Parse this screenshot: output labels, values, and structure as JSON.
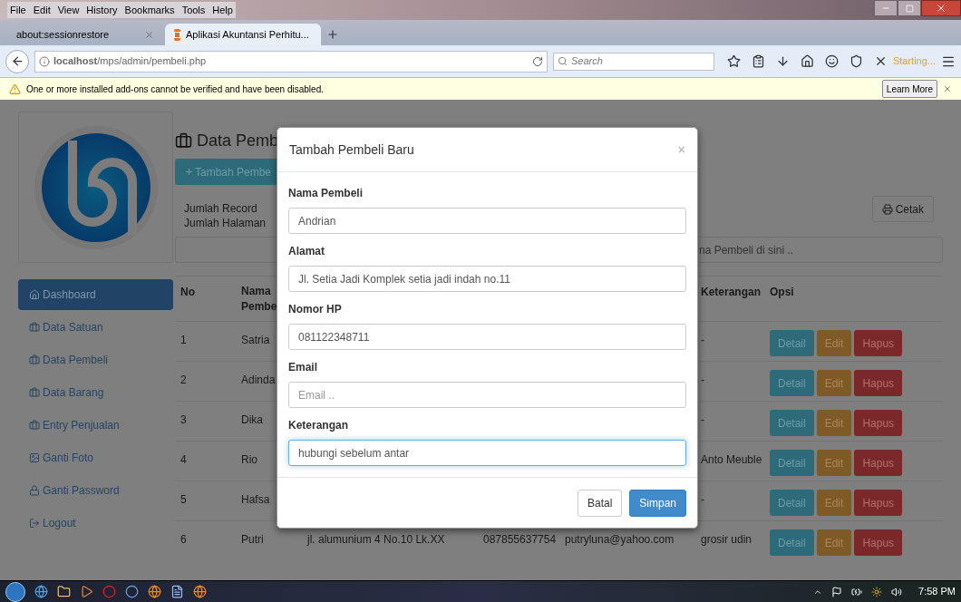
{
  "menu_bar": [
    "File",
    "Edit",
    "View",
    "History",
    "Bookmarks",
    "Tools",
    "Help"
  ],
  "tabs": [
    {
      "label": "about:sessionrestore",
      "selected": false
    },
    {
      "label": "Aplikasi Akuntansi Perhitu...",
      "selected": true
    }
  ],
  "address_bar": {
    "url": "**localhost**/mps/admin/pembeli.php"
  },
  "search": {
    "placeholder": "Search"
  },
  "toolbar_status": "Starting...",
  "notification": {
    "message": "One or more installed add-ons cannot be verified and have been disabled.",
    "button": "Learn More"
  },
  "sidebar": {
    "items": [
      {
        "label": "Dashboard",
        "kind": "home",
        "selected": true
      },
      {
        "label": "Data Satuan",
        "kind": "data",
        "selected": false
      },
      {
        "label": "Data Pembeli",
        "kind": "data",
        "selected": false
      },
      {
        "label": "Data Barang",
        "kind": "data",
        "selected": false
      },
      {
        "label": "Entry Penjualan",
        "kind": "data",
        "selected": false
      },
      {
        "label": "Ganti Foto",
        "kind": "photo",
        "selected": false
      },
      {
        "label": "Ganti Password",
        "kind": "password",
        "selected": false
      },
      {
        "label": "Logout",
        "kind": "logout",
        "selected": false
      }
    ]
  },
  "page": {
    "title": "Data Pemb",
    "add_button": "Tambah Pembe",
    "stats": [
      "Jumlah Record",
      "Jumlah Halaman"
    ],
    "print_button": "Cetak",
    "search_placeholder": "na Pembeli di sini .."
  },
  "table": {
    "columns": [
      "No",
      "Nama Pembe",
      "Keterangan",
      "Opsi"
    ],
    "rows": [
      {
        "no": "1",
        "name": "Satria",
        "keterangan": "-",
        "actions": [
          {
            "label": "Detail",
            "kind": "info"
          },
          {
            "label": "Edit",
            "kind": "warning"
          },
          {
            "label": "Hapus",
            "kind": "danger"
          }
        ]
      },
      {
        "no": "2",
        "name": "Adinda",
        "keterangan": "-",
        "actions": [
          {
            "label": "Detail",
            "kind": "info"
          },
          {
            "label": "Edit",
            "kind": "warning"
          },
          {
            "label": "Hapus",
            "kind": "danger"
          }
        ]
      },
      {
        "no": "3",
        "name": "Dika",
        "keterangan": "-",
        "actions": [
          {
            "label": "Detail",
            "kind": "info"
          },
          {
            "label": "Edit",
            "kind": "warning"
          },
          {
            "label": "Hapus",
            "kind": "danger"
          }
        ]
      },
      {
        "no": "4",
        "name": "Rio",
        "keterangan": "Anto Meuble",
        "actions": [
          {
            "label": "Detail",
            "kind": "info"
          },
          {
            "label": "Edit",
            "kind": "warning"
          },
          {
            "label": "Hapus",
            "kind": "danger"
          }
        ]
      },
      {
        "no": "5",
        "name": "Hafsa",
        "keterangan": "-",
        "actions": [
          {
            "label": "Detail",
            "kind": "info"
          },
          {
            "label": "Edit",
            "kind": "warning"
          },
          {
            "label": "Hapus",
            "kind": "danger"
          }
        ]
      },
      {
        "no": "6",
        "name": "Putri",
        "alamat": "jl. alumunium 4 No.10 Lk.XX",
        "hp": "087855637754",
        "email": "putryluna@yahoo.com",
        "keterangan": "grosir udin",
        "actions": [
          {
            "label": "Detail",
            "kind": "info"
          },
          {
            "label": "Edit",
            "kind": "warning"
          },
          {
            "label": "Hapus",
            "kind": "danger"
          }
        ]
      }
    ]
  },
  "modal": {
    "title": "Tambah Pembeli Baru",
    "close": "×",
    "fields": [
      {
        "label": "Nama Pembeli",
        "value": "Andrian",
        "focused": false
      },
      {
        "label": "Alamat",
        "value": "Jl. Setia Jadi Komplek setia jadi indah no.11",
        "focused": false
      },
      {
        "label": "Nomor HP",
        "value": "081122348711",
        "focused": false
      },
      {
        "label": "Email",
        "placeholder": "Email ..",
        "focused": false
      },
      {
        "label": "Keterangan",
        "value": "hubungi sebelum antar",
        "focused": true
      }
    ],
    "buttons": [
      {
        "label": "Batal",
        "kind": "default"
      },
      {
        "label": "Simpan",
        "kind": "primary"
      }
    ]
  },
  "taskbar": {
    "clock": "7:58 PM"
  }
}
